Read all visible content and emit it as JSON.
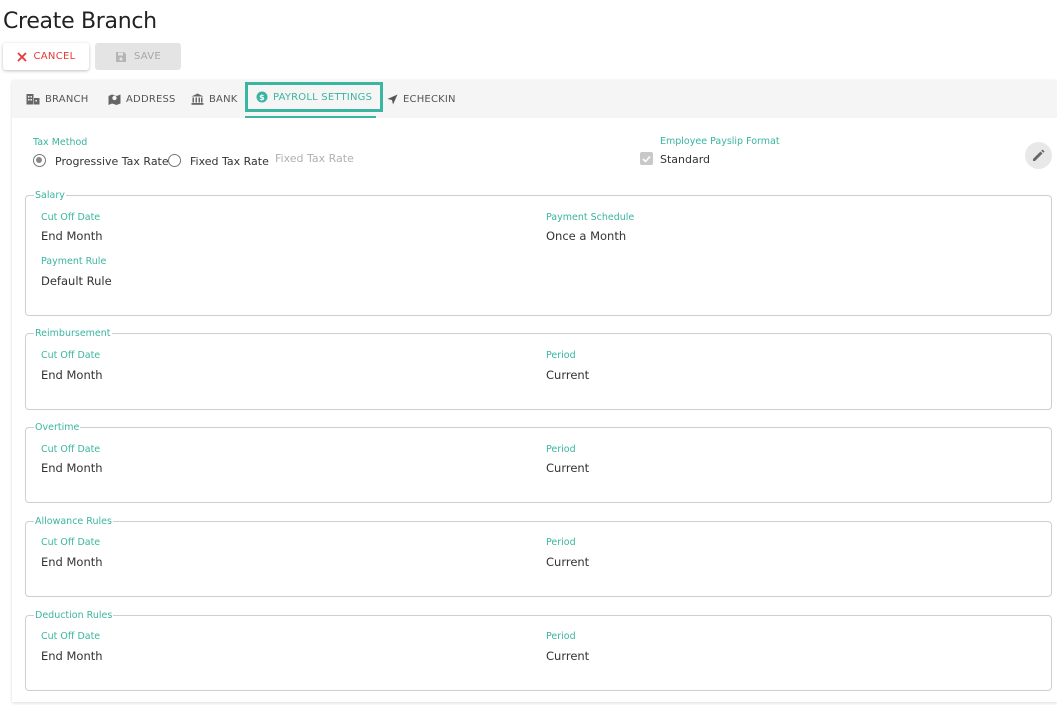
{
  "page": {
    "title": "Create Branch"
  },
  "actions": {
    "cancel_label": "CANCEL",
    "save_label": "SAVE"
  },
  "tabs": [
    {
      "label": "BRANCH",
      "icon": "building-icon"
    },
    {
      "label": "ADDRESS",
      "icon": "map-icon"
    },
    {
      "label": "BANK",
      "icon": "bank-icon"
    },
    {
      "label": "PAYROLL SETTINGS",
      "icon": "dollar-icon",
      "active": true
    },
    {
      "label": "ECHECKIN",
      "icon": "navigation-arrow-icon"
    }
  ],
  "tax_method": {
    "label": "Tax Method",
    "options": [
      "Progressive Tax Rate",
      "Fixed Tax Rate"
    ],
    "selected": "Progressive Tax Rate",
    "fixed_rate_placeholder": "Fixed Tax Rate"
  },
  "payslip": {
    "label": "Employee Payslip Format",
    "value": "Standard",
    "checked": true
  },
  "sections": {
    "salary": {
      "title": "Salary",
      "cutoff_label": "Cut Off Date",
      "cutoff_value": "End Month",
      "schedule_label": "Payment Schedule",
      "schedule_value": "Once a Month",
      "rule_label": "Payment Rule",
      "rule_value": "Default Rule"
    },
    "reimbursement": {
      "title": "Reimbursement",
      "cutoff_label": "Cut Off Date",
      "cutoff_value": "End Month",
      "period_label": "Period",
      "period_value": "Current"
    },
    "overtime": {
      "title": "Overtime",
      "cutoff_label": "Cut Off Date",
      "cutoff_value": "End Month",
      "period_label": "Period",
      "period_value": "Current"
    },
    "allowance": {
      "title": "Allowance Rules",
      "cutoff_label": "Cut Off Date",
      "cutoff_value": "End Month",
      "period_label": "Period",
      "period_value": "Current"
    },
    "deduction": {
      "title": "Deduction Rules",
      "cutoff_label": "Cut Off Date",
      "cutoff_value": "End Month",
      "period_label": "Period",
      "period_value": "Current"
    }
  },
  "colors": {
    "accent": "#3ab5a0",
    "cancel": "#e53935",
    "disabled": "#a6a6a6"
  }
}
